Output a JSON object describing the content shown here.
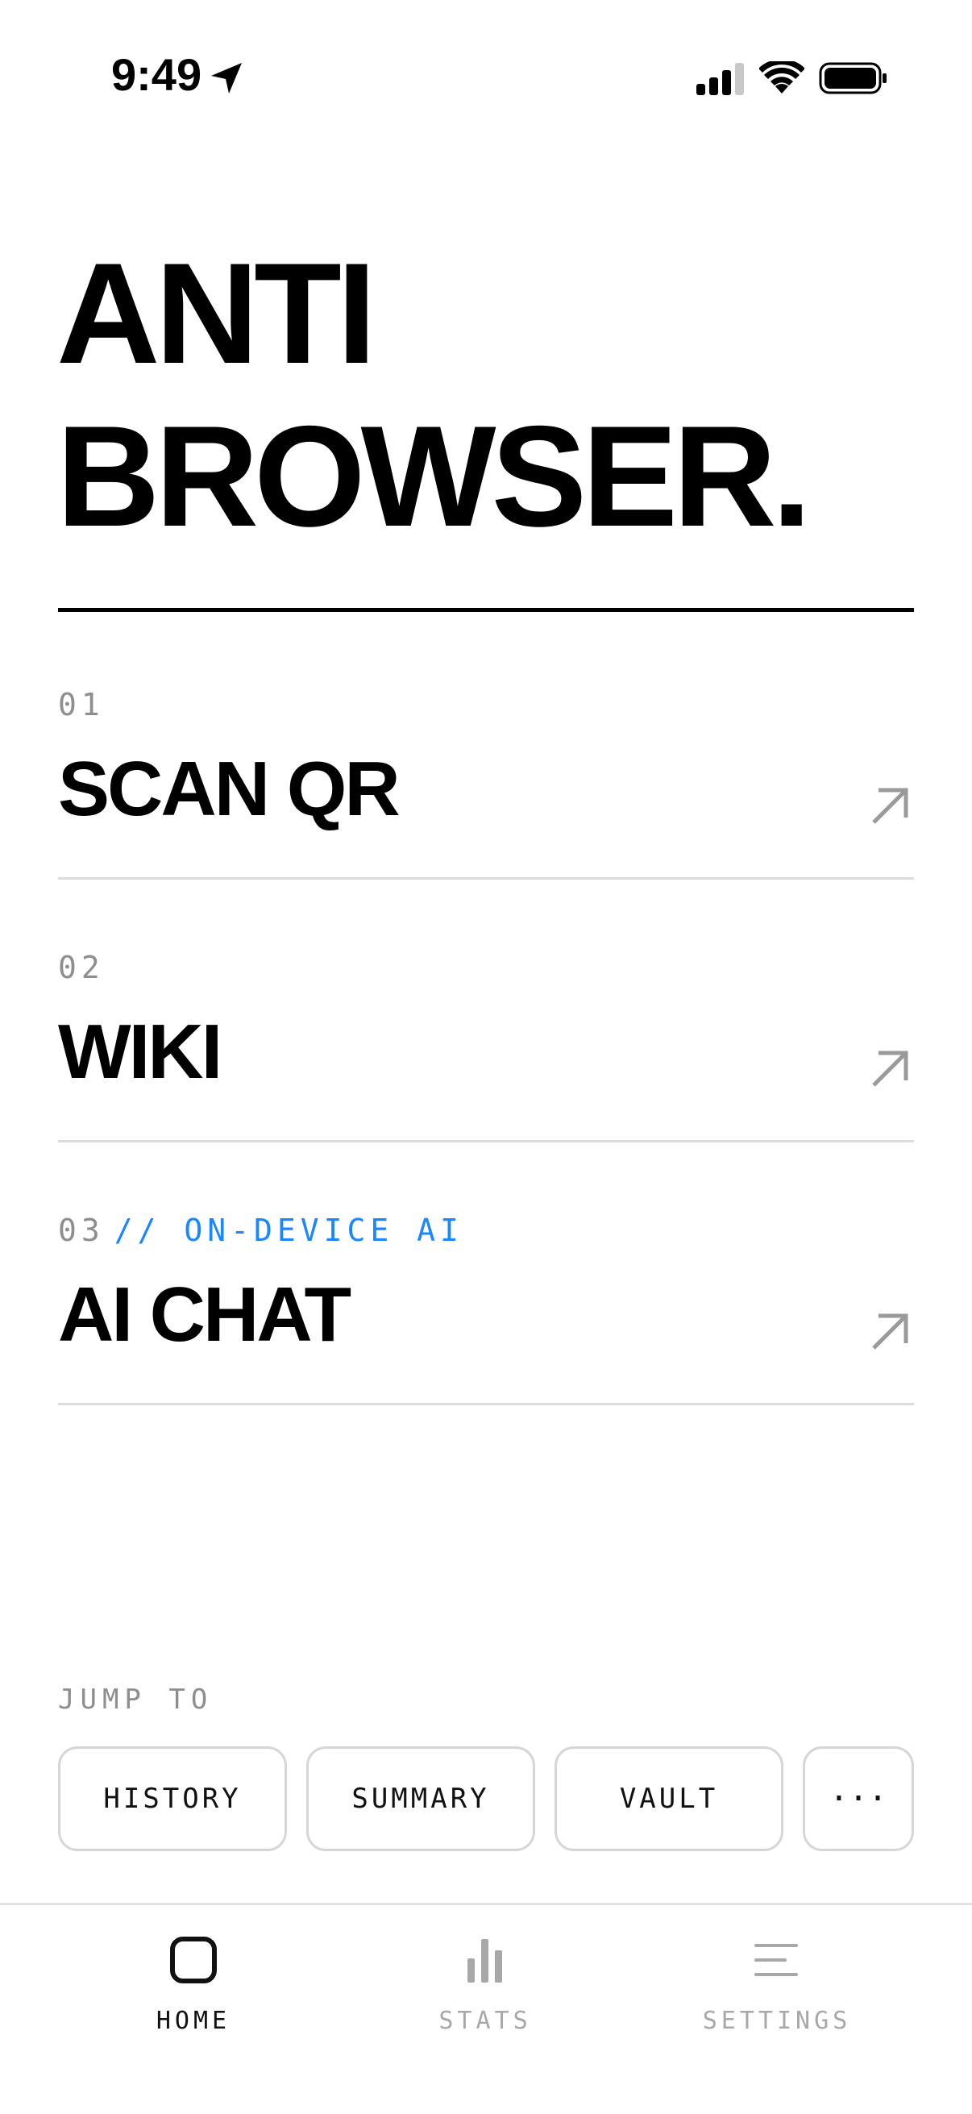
{
  "status_bar": {
    "time": "9:49",
    "icons": [
      "location-arrow-icon",
      "cellular-signal-icon",
      "wifi-icon",
      "battery-icon"
    ]
  },
  "hero": {
    "line1": "ANTI",
    "line2": "BROWSER."
  },
  "menu": {
    "items": [
      {
        "number": "01",
        "tag": "",
        "label": "SCAN QR",
        "icon": "arrow-up-right-icon"
      },
      {
        "number": "02",
        "tag": "",
        "label": "WIKI",
        "icon": "arrow-up-right-icon"
      },
      {
        "number": "03",
        "tag": "// ON-DEVICE AI",
        "label": "AI CHAT",
        "icon": "arrow-up-right-icon"
      }
    ]
  },
  "jump_to": {
    "heading": "JUMP TO",
    "buttons": [
      "HISTORY",
      "SUMMARY",
      "VAULT",
      "···"
    ]
  },
  "tab_bar": {
    "tabs": [
      {
        "label": "HOME",
        "icon": "home-square-icon",
        "active": true
      },
      {
        "label": "STATS",
        "icon": "bar-chart-icon",
        "active": false
      },
      {
        "label": "SETTINGS",
        "icon": "menu-lines-icon",
        "active": false
      }
    ]
  },
  "colors": {
    "accent": "#1a87ff",
    "muted_text": "#8e8e8e",
    "divider": "#dcdcdc",
    "text": "#000000"
  }
}
